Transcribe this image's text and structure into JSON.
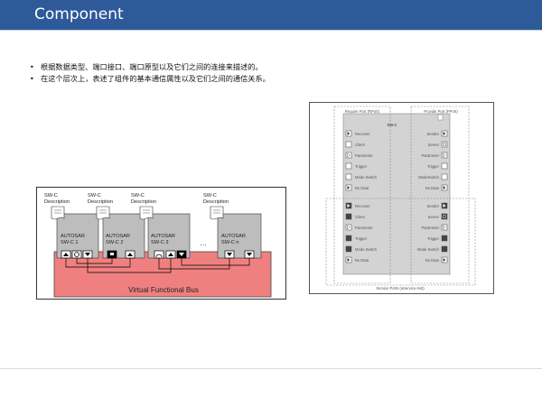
{
  "header": {
    "title": "Component"
  },
  "bullets": [
    "根据数据类型、端口接口、端口原型以及它们之间的连接来描述的。",
    "在这个层次上，表述了组件的基本通信属性以及它们之间的通信关系。"
  ],
  "vfb_figure": {
    "bus_label": "Virtual Functional Bus",
    "ellipsis": "…",
    "components": [
      {
        "desc1": "SW-C",
        "desc2": "Description",
        "name1": "AUTOSAR",
        "name2": "SW-C 1"
      },
      {
        "desc1": "SW-C",
        "desc2": "Description",
        "name1": "AUTOSAR",
        "name2": "SW-C 2"
      },
      {
        "desc1": "SW-C",
        "desc2": "Description",
        "name1": "AUTOSAR",
        "name2": "SW-C 3"
      },
      {
        "desc1": "SW-C",
        "desc2": "Description",
        "name1": "AUTOSAR",
        "name2": "SW-C n"
      }
    ],
    "colors": {
      "bus": "#f08080",
      "component": "#bdbdbd"
    }
  },
  "port_figure": {
    "require_label": "Require Port (RPort)",
    "provide_label": "Provide Port (PPort)",
    "component_label": "SW-C",
    "service_label": "Service Ports (aService-Inst)",
    "left_ports_top": [
      "Receiver",
      "Client",
      "Parameter",
      "Trigger",
      "Mode Switch",
      "Nv Data"
    ],
    "right_ports_top": [
      "Sender",
      "Server",
      "Parameter",
      "Trigger",
      "ModeSwitch",
      "Nv Data"
    ],
    "left_ports_bottom": [
      "Receiver",
      "Client",
      "Parameter",
      "Trigger",
      "Mode Switch",
      "Nv Data"
    ],
    "right_ports_bottom": [
      "Sender",
      "Server",
      "Parameter",
      "Trigger",
      "Mode Switch",
      "Nv Data"
    ]
  }
}
